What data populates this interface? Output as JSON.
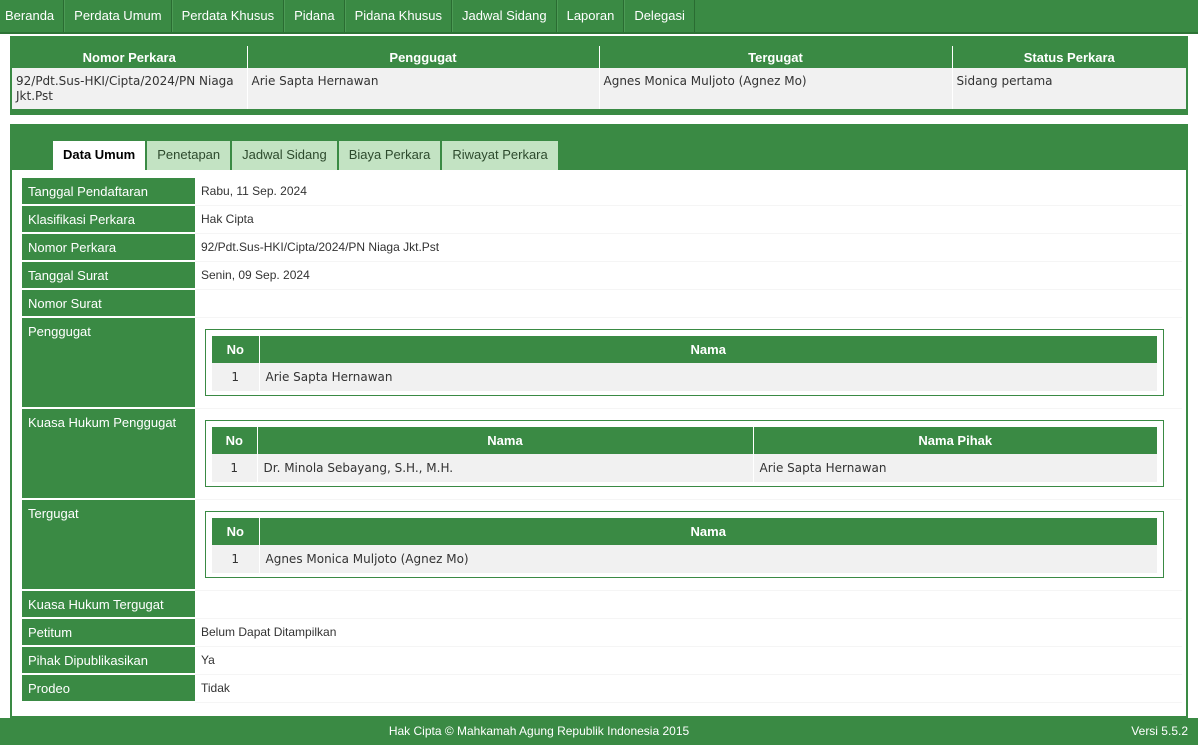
{
  "nav": [
    "Beranda",
    "Perdata Umum",
    "Perdata Khusus",
    "Pidana",
    "Pidana Khusus",
    "Jadwal Sidang",
    "Laporan",
    "Delegasi"
  ],
  "summary": {
    "headers": [
      "Nomor Perkara",
      "Penggugat",
      "Tergugat",
      "Status Perkara"
    ],
    "row": [
      "92/Pdt.Sus-HKI/Cipta/2024/PN Niaga Jkt.Pst",
      "Arie Sapta Hernawan",
      "Agnes Monica Muljoto (Agnez Mo)",
      "Sidang pertama"
    ]
  },
  "tabs": [
    "Data Umum",
    "Penetapan",
    "Jadwal Sidang",
    "Biaya Perkara",
    "Riwayat Perkara"
  ],
  "fields": {
    "tanggal_pendaftaran": {
      "label": "Tanggal Pendaftaran",
      "value": "Rabu, 11 Sep. 2024"
    },
    "klasifikasi_perkara": {
      "label": "Klasifikasi Perkara",
      "value": "Hak Cipta"
    },
    "nomor_perkara": {
      "label": "Nomor Perkara",
      "value": "92/Pdt.Sus-HKI/Cipta/2024/PN Niaga Jkt.Pst"
    },
    "tanggal_surat": {
      "label": "Tanggal Surat",
      "value": "Senin, 09 Sep. 2024"
    },
    "nomor_surat": {
      "label": "Nomor Surat",
      "value": ""
    },
    "penggugat": {
      "label": "Penggugat"
    },
    "kuasa_penggugat": {
      "label": "Kuasa Hukum Penggugat"
    },
    "tergugat": {
      "label": "Tergugat"
    },
    "kuasa_tergugat": {
      "label": "Kuasa Hukum Tergugat",
      "value": ""
    },
    "petitum": {
      "label": "Petitum",
      "value": "Belum Dapat Ditampilkan"
    },
    "pihak_dipublikasikan": {
      "label": "Pihak Dipublikasikan",
      "value": "Ya"
    },
    "prodeo": {
      "label": "Prodeo",
      "value": "Tidak"
    }
  },
  "penggugat_table": {
    "headers": [
      "No",
      "Nama"
    ],
    "rows": [
      [
        "1",
        "Arie Sapta Hernawan"
      ]
    ]
  },
  "kuasa_penggugat_table": {
    "headers": [
      "No",
      "Nama",
      "Nama Pihak"
    ],
    "rows": [
      [
        "1",
        "Dr. Minola Sebayang, S.H., M.H.",
        "Arie Sapta Hernawan"
      ]
    ]
  },
  "tergugat_table": {
    "headers": [
      "No",
      "Nama"
    ],
    "rows": [
      [
        "1",
        "Agnes Monica Muljoto (Agnez Mo)"
      ]
    ]
  },
  "footer": {
    "copyright": "Hak Cipta © Mahkamah Agung Republik Indonesia 2015",
    "version": "Versi 5.5.2"
  },
  "colors": {
    "primary_green": "#3a8a44",
    "tab_inactive": "#c3e3c3",
    "row_bg": "#f1f1f1"
  }
}
